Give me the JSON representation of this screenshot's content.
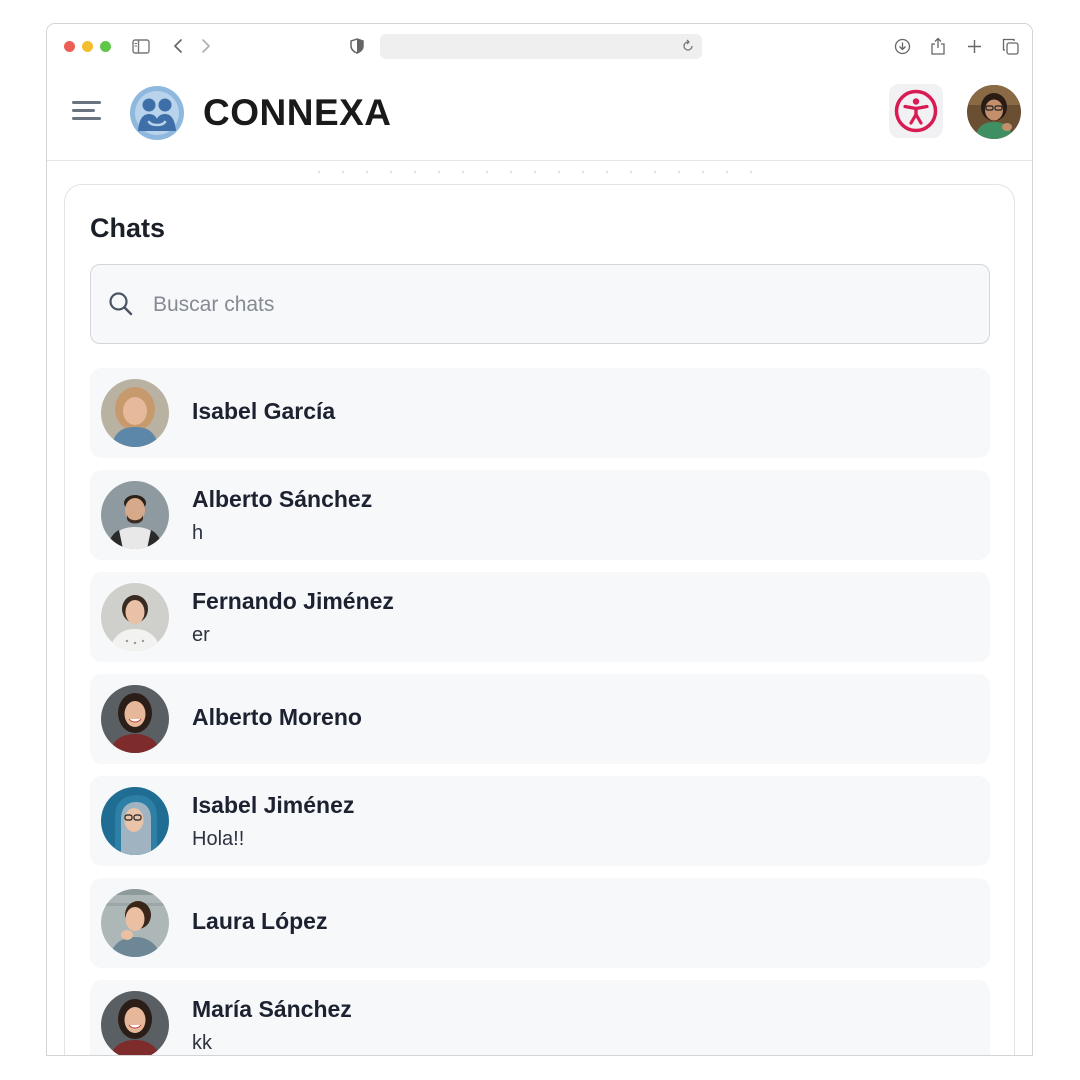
{
  "app": {
    "brand": "CONNEXA"
  },
  "chats_panel": {
    "title": "Chats",
    "search_placeholder": "Buscar chats"
  },
  "chats": [
    {
      "name": "Isabel García",
      "preview": "",
      "avatar_color": "#c79a6e"
    },
    {
      "name": "Alberto Sánchez",
      "preview": "h",
      "avatar_color": "#8e9aa0"
    },
    {
      "name": "Fernando Jiménez",
      "preview": "er",
      "avatar_color": "#cfcfcb"
    },
    {
      "name": "Alberto Moreno",
      "preview": "",
      "avatar_color": "#7d2b2b"
    },
    {
      "name": "Isabel Jiménez",
      "preview": "Hola!!",
      "avatar_color": "#2d7fa6"
    },
    {
      "name": "Laura López",
      "preview": "",
      "avatar_color": "#6d8796"
    },
    {
      "name": "María Sánchez",
      "preview": "kk",
      "avatar_color": "#7d2b2b"
    }
  ],
  "colors": {
    "accessibility_accent": "#d81b53",
    "logo_blue": "#3f78b5"
  }
}
